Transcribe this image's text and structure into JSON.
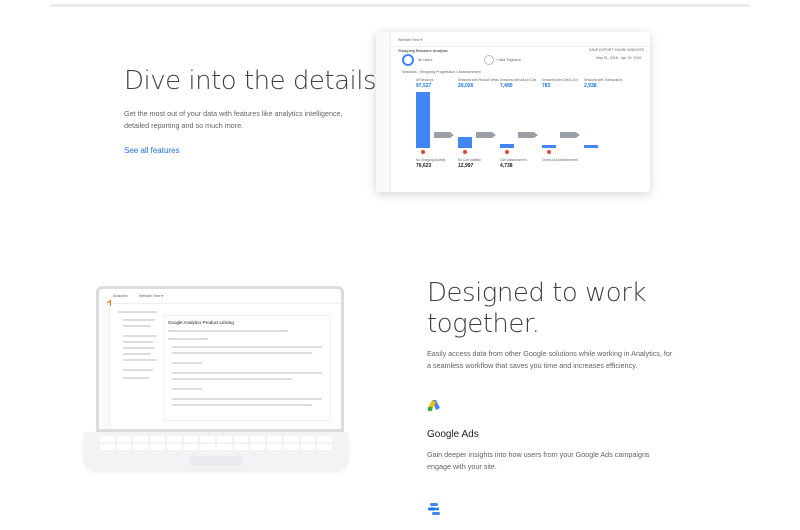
{
  "section1": {
    "heading": "Dive into the details.",
    "body": "Get the most out of your data with features like analytics intelligence, detailed reporting and so much more.",
    "link_label": "See all features"
  },
  "dashboard": {
    "view_label": "Website View ▾",
    "title": "Shopping Behavior Analysis",
    "actions": "SAVE   EXPORT   SHARE   INSIGHTS",
    "date_range": "May 21, 2018 - Apr 19, 2019",
    "segment_all": "All Users",
    "segment_add": "+ Add Segment",
    "legend": "Sessions • Shopping Progression • Abandonment",
    "stages": [
      {
        "label": "All Sessions",
        "value": "97,527"
      },
      {
        "label": "Sessions with Product Views",
        "value": "20,026"
      },
      {
        "label": "Sessions with Add to Cart",
        "value": "7,490"
      },
      {
        "label": "Sessions with Check-Out",
        "value": "783"
      },
      {
        "label": "Sessions with Transactions",
        "value": "2,938"
      }
    ],
    "abandonment": [
      {
        "label": "No Shopping Activity",
        "value": "76,623"
      },
      {
        "label": "No Cart Addition",
        "value": "12,997"
      },
      {
        "label": "Cart Abandonment",
        "value": "4,738"
      },
      {
        "label": "Check-Out Abandonment",
        "value": ""
      }
    ],
    "bar_levels": [
      1.0,
      0.2,
      0.08,
      0.04,
      0.03
    ]
  },
  "section2": {
    "heading_line1": "Designed to work",
    "heading_line2": "together.",
    "body": "Easily access data from other Google solutions while working in Analytics, for a seamless workflow that saves you time and increases efficiency.",
    "product_title": "Google Ads",
    "product_body": "Gain deeper insights into how users from your Google Ads campaigns engage with your site."
  },
  "laptop": {
    "app_name": "Analytics",
    "view_label": "Website View ▾",
    "panel_title": "Google Analytics Product Linking"
  },
  "colors": {
    "accent": "#1a73e8",
    "bar_blue": "#4285f4",
    "ads_yellow": "#fbbc04",
    "ads_blue": "#4285f4",
    "ads_green": "#34a853"
  },
  "icons": [
    "google-ads-icon",
    "data-studio-icon"
  ]
}
